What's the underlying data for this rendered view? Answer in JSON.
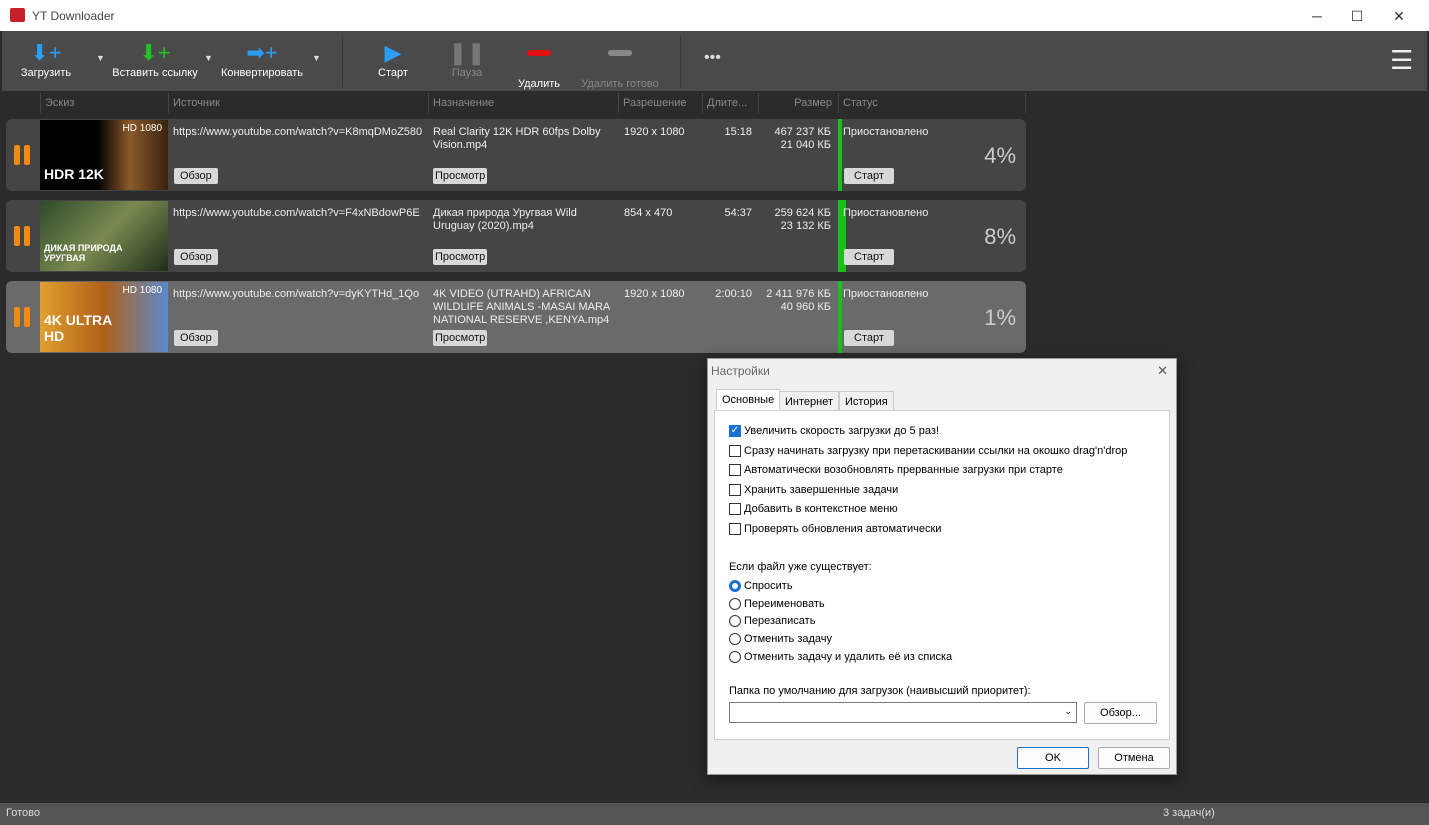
{
  "window": {
    "title": "YT Downloader",
    "minimize": "─",
    "maximize": "☐",
    "close": "✕"
  },
  "toolbar": {
    "download": "Загрузить",
    "paste": "Вставить ссылку",
    "convert": "Конвертировать",
    "start": "Старт",
    "pause": "Пауза",
    "delete": "Удалить",
    "delete_done": "Удалить готово",
    "more": "•••",
    "menu": "☰",
    "dropdown": "▼"
  },
  "columns": [
    "Эскиз",
    "Источник",
    "Назначение",
    "Разрешение",
    "Длите...",
    "Размер",
    "Статус"
  ],
  "rows": [
    {
      "thumb_label": "HD 1080",
      "thumb_text": "HDR 12K",
      "source": "https://www.youtube.com/watch?v=K8mqDMoZ580",
      "dest": "Real Clarity 12K HDR 60fps  Dolby Vision.mp4",
      "res": "1920 x 1080",
      "dur": "15:18",
      "size_total": "467 237 КБ",
      "size_done": "21 040 КБ",
      "status": "Приостановлено",
      "pct": "4%",
      "progress": 4,
      "browse": "Обзор",
      "view": "Просмотр",
      "start": "Старт"
    },
    {
      "thumb_label": "",
      "thumb_text": "ДИКАЯ ПРИРОДА УРУГВАЯ",
      "source": "https://www.youtube.com/watch?v=F4xNBdowP6E",
      "dest": "Дикая природа Уругвая   Wild Uruguay (2020).mp4",
      "res": "854 x 470",
      "dur": "54:37",
      "size_total": "259 624 КБ",
      "size_done": "23 132 КБ",
      "status": "Приостановлено",
      "pct": "8%",
      "progress": 8,
      "browse": "Обзор",
      "view": "Просмотр",
      "start": "Старт"
    },
    {
      "thumb_label": "HD 1080",
      "thumb_text": "4K ULTRA HD",
      "source": "https://www.youtube.com/watch?v=dyKYTHd_1Qo",
      "dest": "4K VIDEO (UTRAHD) AFRICAN WILDLIFE ANIMALS -MASAI MARA NATIONAL RESERVE ,KENYA.mp4",
      "res": "1920 x 1080",
      "dur": "2:00:10",
      "size_total": "2 411 976 КБ",
      "size_done": "40 960 КБ",
      "status": "Приостановлено",
      "pct": "1%",
      "progress": 1,
      "browse": "Обзор",
      "view": "Просмотр",
      "start": "Старт"
    }
  ],
  "statusbar": {
    "left": "Готово",
    "right": "3 задач(и)"
  },
  "dialog": {
    "title": "Настройки",
    "close": "✕",
    "tabs": [
      "Основные",
      "Интернет",
      "История"
    ],
    "checkboxes": [
      {
        "label": "Увеличить скорость загрузки до 5 раз!",
        "checked": true
      },
      {
        "label": "Сразу начинать загрузку при перетаскивании ссылки на окошко drag'n'drop",
        "checked": false
      },
      {
        "label": "Автоматически возобновлять прерванные загрузки при старте",
        "checked": false
      },
      {
        "label": "Хранить завершенные задачи",
        "checked": false
      },
      {
        "label": "Добавить в контекстное меню",
        "checked": false
      },
      {
        "label": "Проверять обновления автоматически",
        "checked": false
      }
    ],
    "exists_label": "Если файл уже существует:",
    "radios": [
      {
        "label": "Спросить",
        "checked": true
      },
      {
        "label": "Переименовать",
        "checked": false
      },
      {
        "label": "Перезаписать",
        "checked": false
      },
      {
        "label": "Отменить задачу",
        "checked": false
      },
      {
        "label": "Отменить задачу и удалить её из списка",
        "checked": false
      }
    ],
    "folder_label": "Папка по умолчанию для загрузок (наивысший приоритет):",
    "folder_value": "",
    "browse": "Обзор...",
    "ok": "OK",
    "cancel": "Отмена"
  }
}
